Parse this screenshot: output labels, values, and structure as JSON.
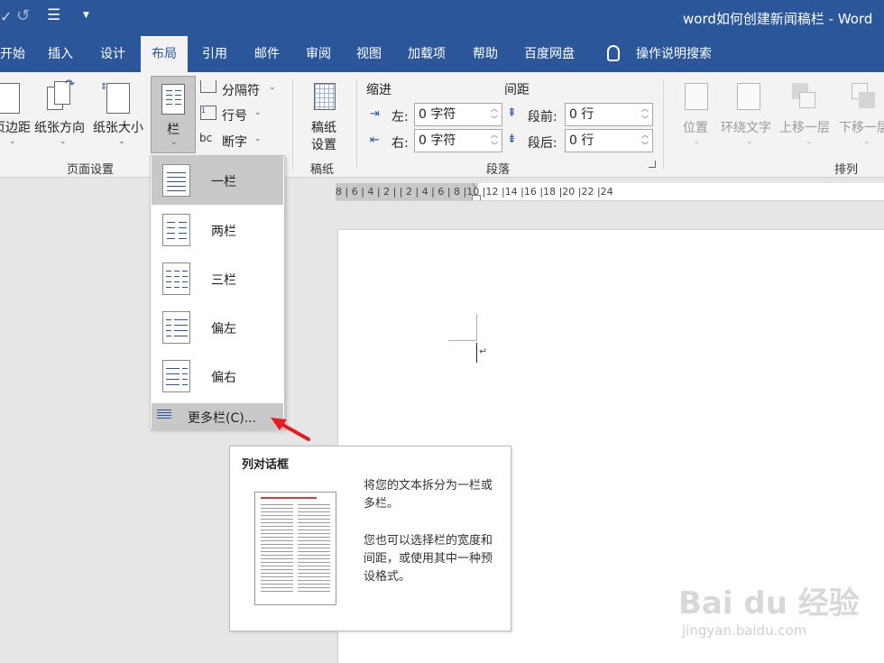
{
  "titlebar": {
    "doc_title": "word如何创建新闻稿栏 - Word"
  },
  "tabs": [
    "开始",
    "插入",
    "设计",
    "布局",
    "引用",
    "邮件",
    "审阅",
    "视图",
    "加载项",
    "帮助",
    "百度网盘"
  ],
  "active_tab": "布局",
  "search": {
    "label": "操作说明搜索"
  },
  "ribbon": {
    "page_setup": {
      "group_label": "页面设置",
      "margins": "页边距",
      "orientation": "纸张方向",
      "size": "纸张大小",
      "columns": "栏",
      "breaks": "分隔符",
      "line_numbers": "行号",
      "hyphenation": "断字"
    },
    "manuscript": {
      "group_label": "稿纸",
      "button_line1": "稿纸",
      "button_line2": "设置"
    },
    "paragraph": {
      "group_label": "段落",
      "indent_header": "缩进",
      "spacing_header": "间距",
      "left_label": "左:",
      "left_value": "0 字符",
      "right_label": "右:",
      "right_value": "0 字符",
      "before_label": "段前:",
      "before_value": "0 行",
      "after_label": "段后:",
      "after_value": "0 行"
    },
    "arrange": {
      "group_label": "排列",
      "position": "位置",
      "wrap_text": "环绕文字",
      "bring_forward": "上移一层",
      "send_backward": "下移一层"
    }
  },
  "ruler": {
    "text": "8 | 6 | 4 | 2 |   | 2 | 4 | 6 | 8 |10 |12 |14 |16 |18 |20 |22 |24"
  },
  "columns_menu": {
    "items": [
      "一栏",
      "两栏",
      "三栏",
      "偏左",
      "偏右"
    ],
    "more": "更多栏(C)..."
  },
  "tooltip": {
    "title": "列对话框",
    "para1": "将您的文本拆分为一栏或多栏。",
    "para2": "您也可以选择栏的宽度和间距，或使用其中一种预设格式。"
  },
  "watermark": {
    "brand": "Bai du 经验",
    "url": "jingyan.baidu.com"
  },
  "colors": {
    "word_blue": "#2b579a",
    "ribbon_bg": "#f3f3f3",
    "arrow_red": "#e8191f"
  }
}
